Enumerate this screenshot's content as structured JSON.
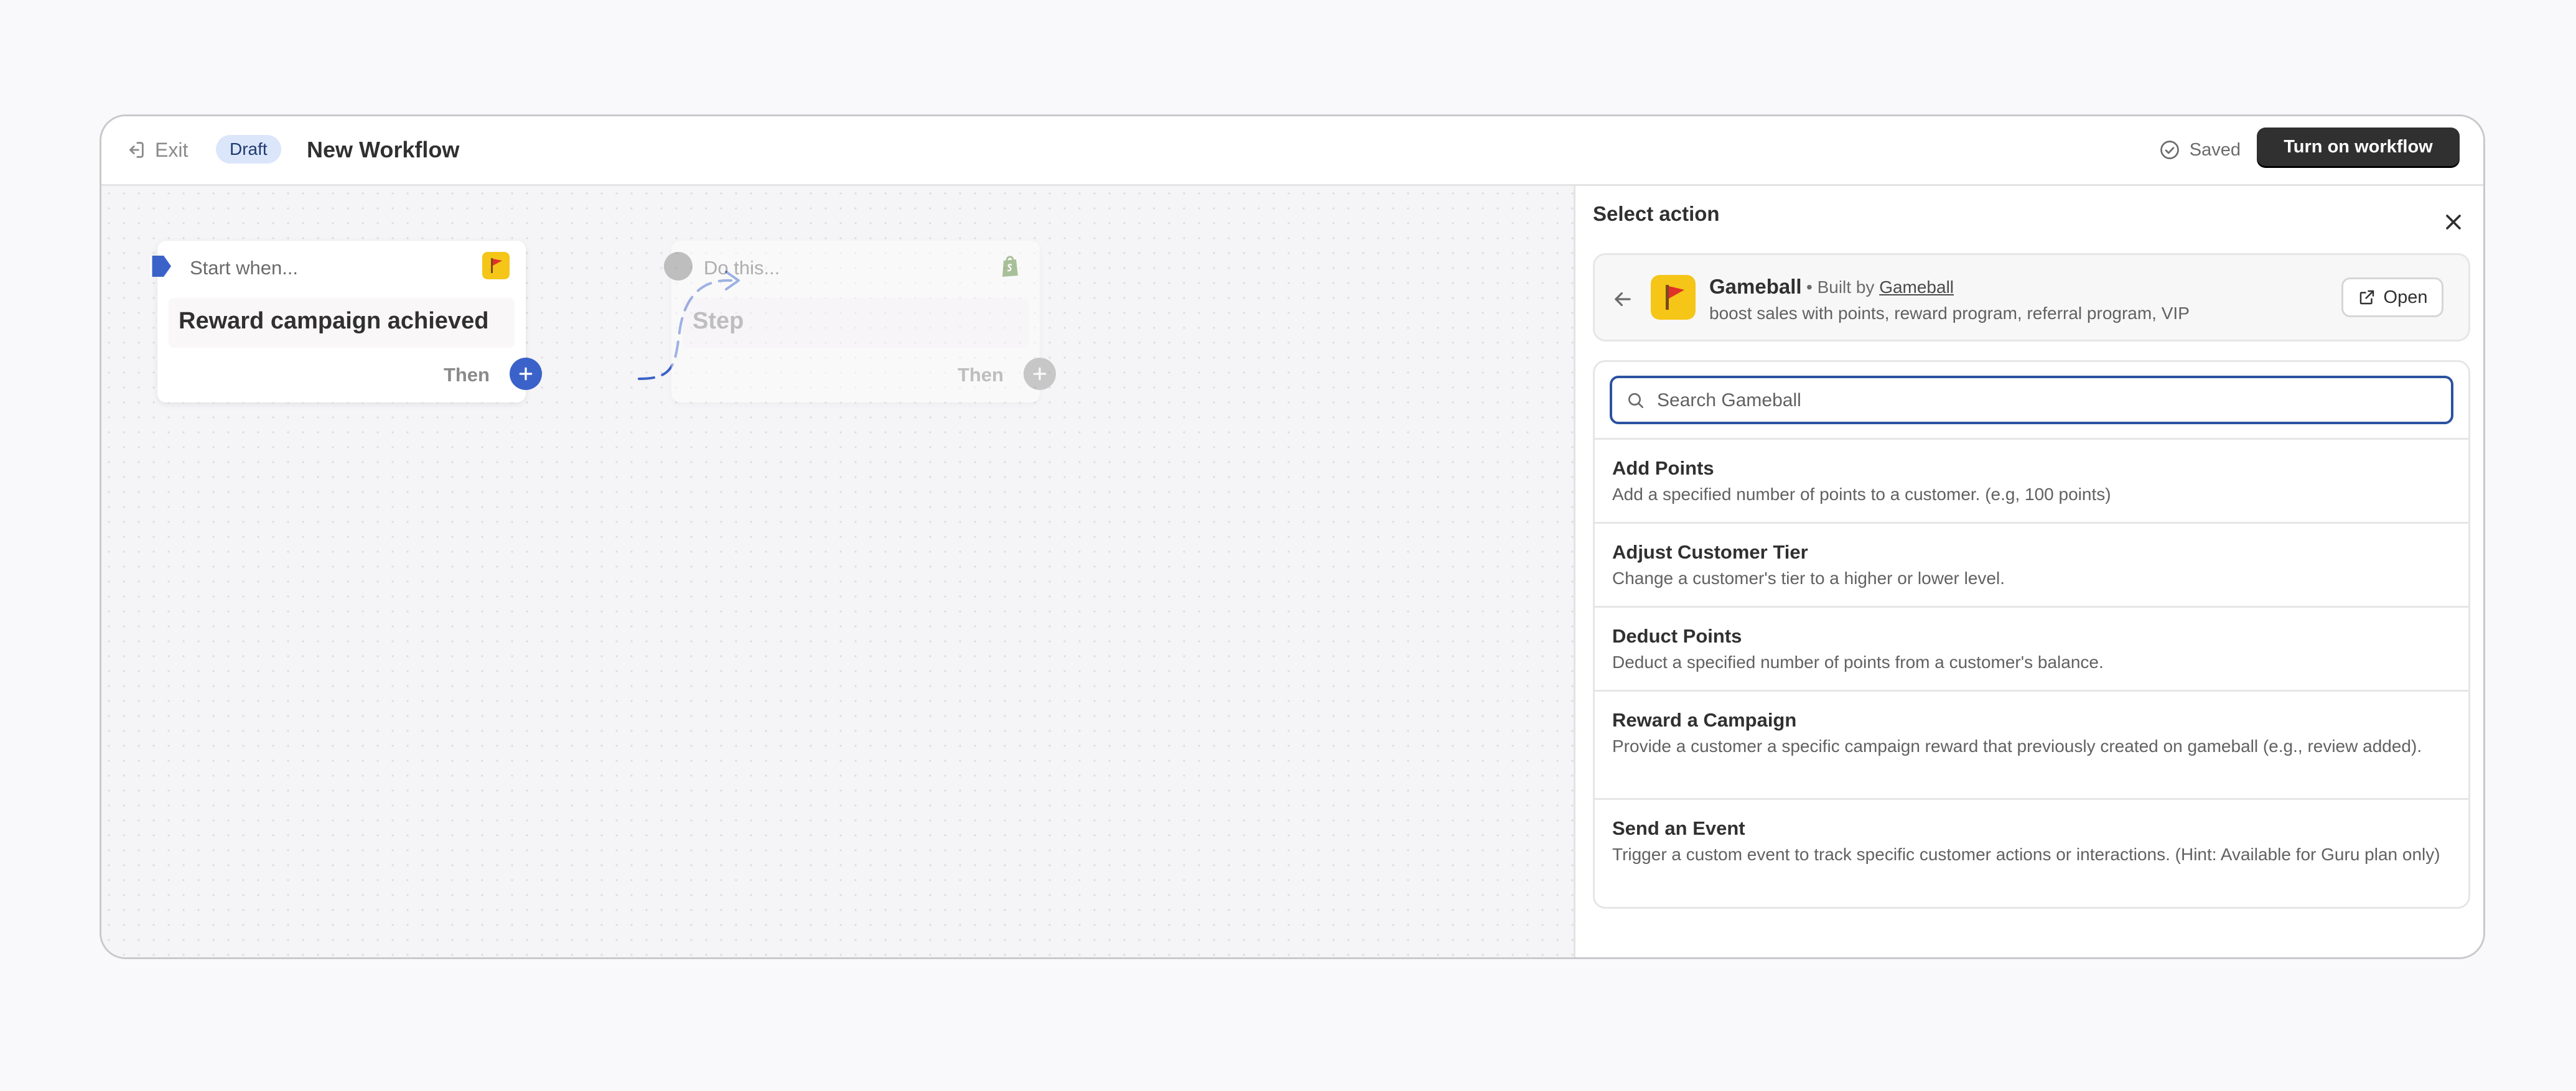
{
  "topbar": {
    "exit_label": "Exit",
    "status_badge": "Draft",
    "title": "New Workflow",
    "saved_label": "Saved",
    "primary_button": "Turn on workflow"
  },
  "canvas": {
    "trigger": {
      "heading": "Start when...",
      "title": "Reward campaign achieved",
      "then_label": "Then",
      "icon": "gameball-app-icon"
    },
    "step": {
      "heading": "Do this...",
      "title": "Step",
      "then_label": "Then",
      "icon": "shopify-app-icon"
    }
  },
  "panel": {
    "title": "Select action",
    "app": {
      "name": "Gameball",
      "built_by_prefix": "• Built by",
      "developer": "Gameball",
      "description": "boost sales with points, reward program, referral program, VIP",
      "open_label": "Open"
    },
    "search": {
      "placeholder": "Search Gameball",
      "value": ""
    },
    "actions": [
      {
        "title": "Add Points",
        "description": "Add a specified number of points to a customer. (e.g, 100 points)"
      },
      {
        "title": "Adjust Customer Tier",
        "description": "Change a customer's tier to a higher or lower level."
      },
      {
        "title": "Deduct Points",
        "description": "Deduct a specified number of points from a customer's balance."
      },
      {
        "title": "Reward a Campaign",
        "description": "Provide a customer a specific campaign reward that previously created on gameball (e.g., review added)."
      },
      {
        "title": "Send an Event",
        "description": "Trigger a custom event to track specific customer actions or interactions. (Hint: Available for Guru plan only)"
      }
    ]
  },
  "colors": {
    "accent": "#2c52a0",
    "connector": "#3b62c9",
    "primary_button": "#303030",
    "badge_bg": "#dbe6fb"
  }
}
